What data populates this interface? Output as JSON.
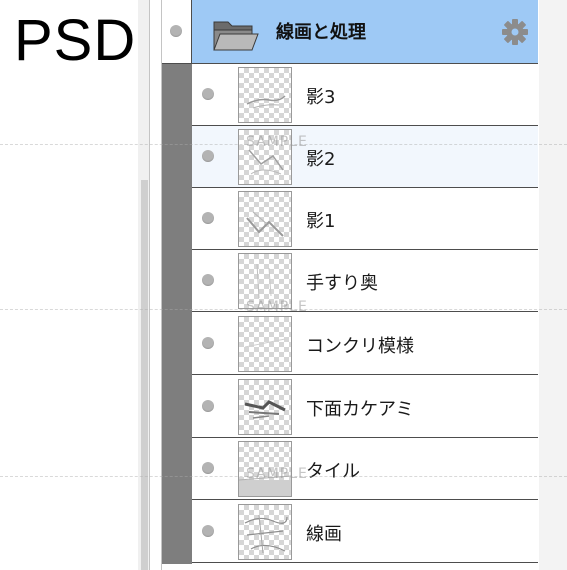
{
  "header": {
    "format_label": "PSD"
  },
  "folder": {
    "name": "線画と処理",
    "icon": "folder-icon",
    "settings_icon": "gear-icon"
  },
  "layers": [
    {
      "name": "影3",
      "selected": false
    },
    {
      "name": "影2",
      "selected": true
    },
    {
      "name": "影1",
      "selected": false
    },
    {
      "name": "手すり奥",
      "selected": false
    },
    {
      "name": "コンクリ模様",
      "selected": false
    },
    {
      "name": "下面カケアミ",
      "selected": false
    },
    {
      "name": "タイル",
      "selected": false
    },
    {
      "name": "線画",
      "selected": false
    }
  ],
  "watermark": {
    "text": "SAMPLE"
  },
  "colors": {
    "folder_highlight": "#9ec9f5",
    "selected_row": "#f2f7fd",
    "strip": "#7e7e7e"
  }
}
